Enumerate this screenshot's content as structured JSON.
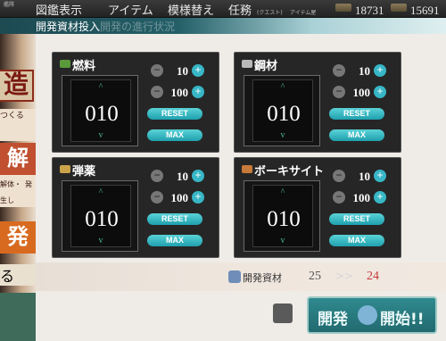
{
  "topbar": {
    "left_sub": "艦隊",
    "items": [
      "図鑑表示",
      "アイテム",
      "模様替え",
      "任務"
    ],
    "quest_sub": "(クエスト)",
    "item_shop_sub": "アイテム屋",
    "resources": [
      "18731",
      "15691"
    ]
  },
  "subbar": {
    "title": "開発資材投入",
    "ghost_text": "開発の進行状況"
  },
  "left_panel": {
    "labels": [
      "造",
      "つくる",
      "解体",
      "解体・",
      "発生し",
      "発",
      "る"
    ]
  },
  "panels": [
    {
      "title": "燃料",
      "icon_color": "#5a9a3a",
      "value": "010",
      "step_small": "10",
      "step_large": "100",
      "reset": "RESET",
      "max": "MAX"
    },
    {
      "title": "鋼材",
      "icon_color": "#b8b8b8",
      "value": "010",
      "step_small": "10",
      "step_large": "100",
      "reset": "RESET",
      "max": "MAX"
    },
    {
      "title": "弾薬",
      "icon_color": "#c9a24a",
      "value": "010",
      "step_small": "10",
      "step_large": "100",
      "reset": "RESET",
      "max": "MAX"
    },
    {
      "title": "ボーキサイト",
      "icon_color": "#c77a3a",
      "value": "010",
      "step_small": "10",
      "step_large": "100",
      "reset": "RESET",
      "max": "MAX"
    }
  ],
  "development": {
    "label": "開発資材",
    "current": "25",
    "arrows": ">>",
    "after": "24"
  },
  "start_button": {
    "left": "開発",
    "right": "開始!!"
  },
  "symbols": {
    "up": "^",
    "down": "v",
    "minus": "−",
    "plus": "+"
  }
}
